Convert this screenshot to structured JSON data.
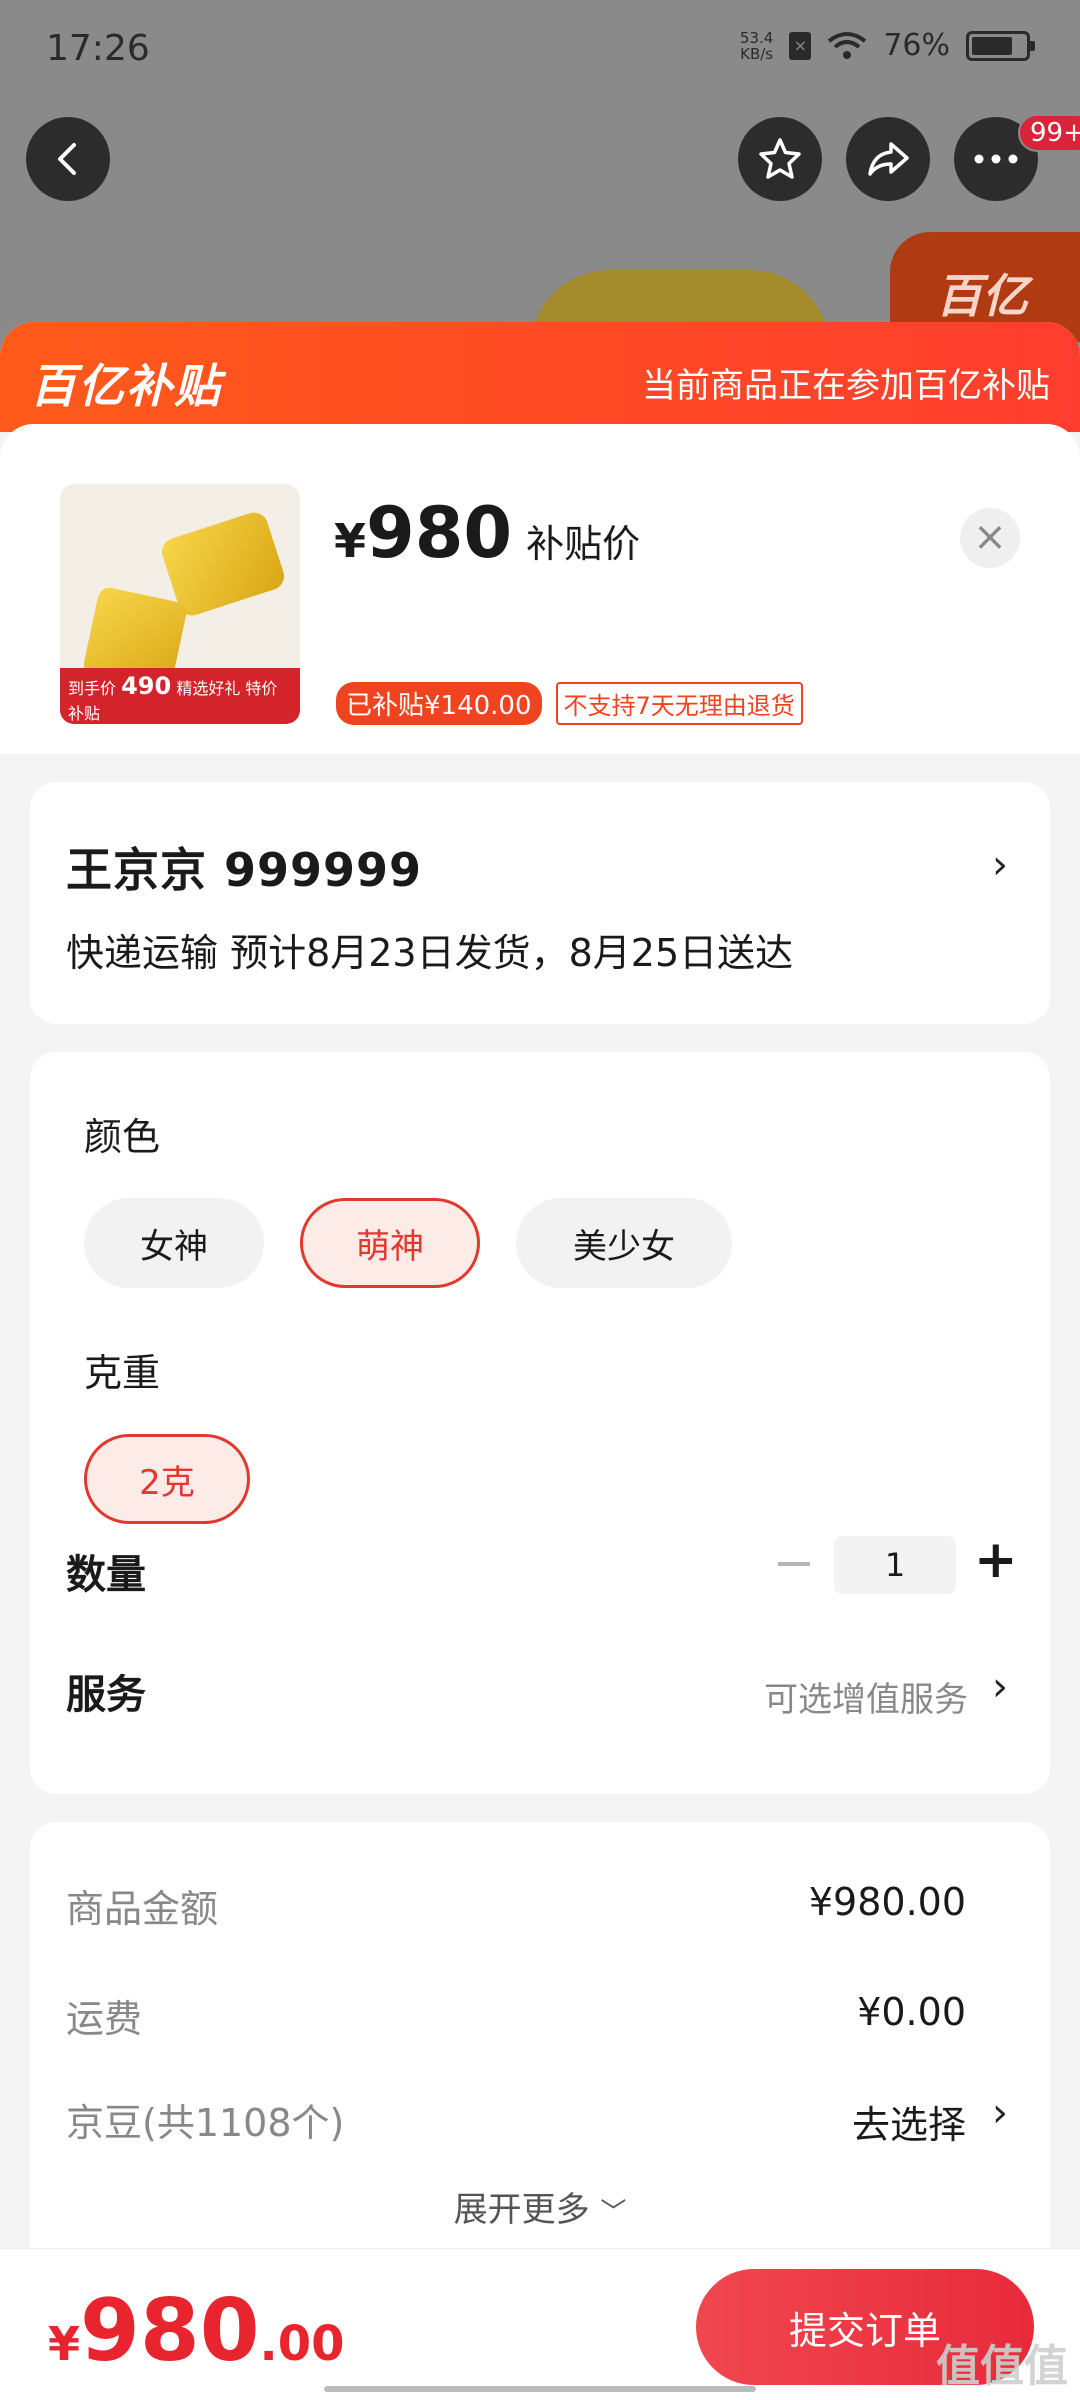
{
  "status": {
    "time": "17:26",
    "net_speed_top": "53.4",
    "net_speed_bottom": "KB/s",
    "battery": "76%",
    "battery_level": 0.76
  },
  "nav": {
    "more_badge": "99+"
  },
  "background": {
    "brand_logo": "百亿"
  },
  "banner": {
    "logo": "百亿补贴",
    "text": "当前商品正在参加百亿补贴"
  },
  "product": {
    "thumb_strip_top": "到手价",
    "thumb_price": "490",
    "thumb_strip_text": "精选好礼 特价补贴",
    "price_symbol": "¥",
    "price": "980",
    "price_label": "补贴价",
    "tag_subsidy": "已补贴¥140.00",
    "tag_return": "不支持7天无理由退货"
  },
  "address": {
    "name_phone": "王京京  999999",
    "shipping": "快递运输 预计8月23日发货，8月25日送达"
  },
  "spec": {
    "color_label": "颜色",
    "colors": [
      "女神",
      "萌神",
      "美少女"
    ],
    "weight_label": "克重",
    "weights": [
      "2克"
    ],
    "quantity_label": "数量",
    "quantity": "1",
    "service_label": "服务",
    "service_hint": "可选增值服务"
  },
  "summary": {
    "goods_label": "商品金额",
    "goods_value": "¥980.00",
    "shipping_label": "运费",
    "shipping_value": "¥0.00",
    "beans_label": "京豆(共1108个)",
    "beans_value": "去选择",
    "expand": "展开更多"
  },
  "footer": {
    "total_symbol": "¥",
    "total_int": "980",
    "total_dec": ".00",
    "submit": "提交订单",
    "watermark": "值值值"
  },
  "colors": {
    "accent": "#e8252e",
    "banner": "#ff4d24",
    "selected_chip": "#e2392f"
  }
}
